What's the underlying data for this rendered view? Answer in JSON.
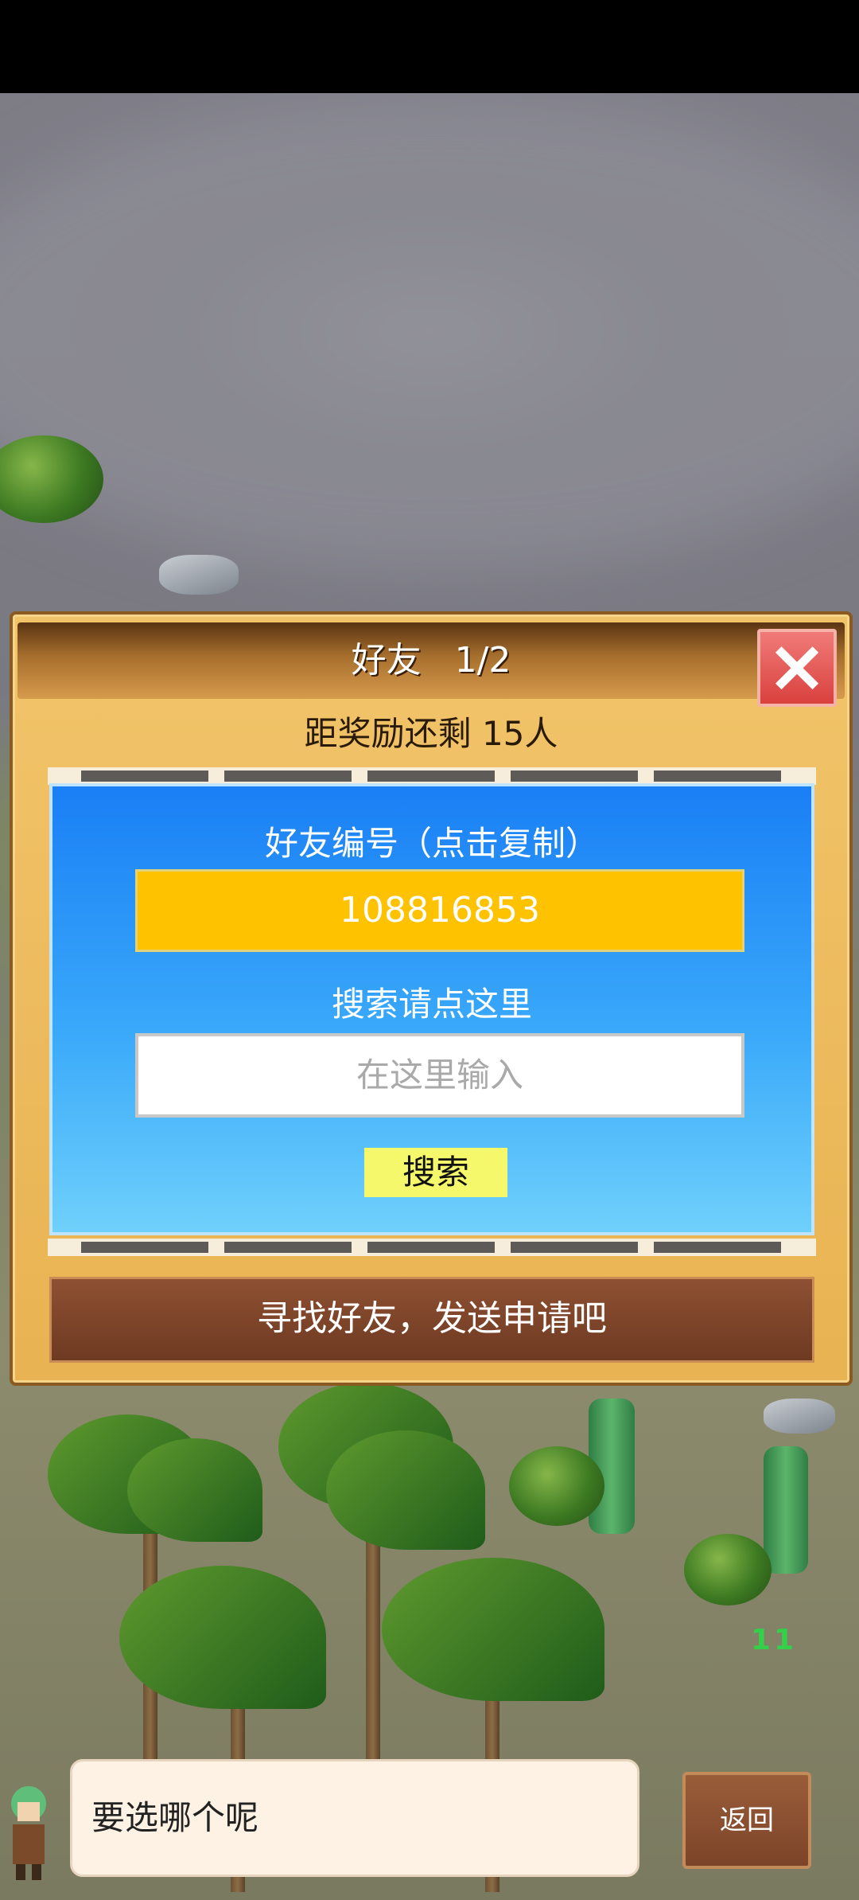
{
  "dialog": {
    "title": "好友",
    "page": "1/2",
    "reward_text": "距奖励还剩 15人",
    "friend_id_label": "好友编号（点击复制）",
    "friend_id": "108816853",
    "search_label": "搜索请点这里",
    "search_placeholder": "在这里输入",
    "search_button": "搜索",
    "find_bar": "寻找好友，发送申请吧"
  },
  "footer": {
    "bubble_text": "要选哪个呢",
    "back_button": "返回"
  },
  "scene": {
    "counter": "11"
  },
  "colors": {
    "panel": "#e8b352",
    "inner": "#1a7ff5",
    "id_box": "#ffc200",
    "search_button": "#f4f86a",
    "close": "#d9413e"
  }
}
